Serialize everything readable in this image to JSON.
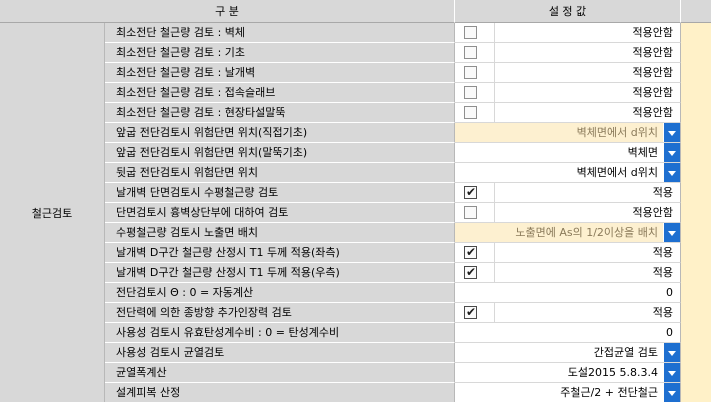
{
  "header": {
    "left": "구          분",
    "right": "설 정 값"
  },
  "category": "철근검토",
  "rows": [
    {
      "label": "최소전단 철근량 검토 : 벽체",
      "kind": "checkbox",
      "checked": false,
      "text": "적용안함"
    },
    {
      "label": "최소전단 철근량 검토 : 기초",
      "kind": "checkbox",
      "checked": false,
      "text": "적용안함"
    },
    {
      "label": "최소전단 철근량 검토 : 날개벽",
      "kind": "checkbox",
      "checked": false,
      "text": "적용안함"
    },
    {
      "label": "최소전단 철근량 검토 : 접속슬래브",
      "kind": "checkbox",
      "checked": false,
      "text": "적용안함"
    },
    {
      "label": "최소전단 철근량 검토 : 현장타설말뚝",
      "kind": "checkbox",
      "checked": false,
      "text": "적용안함"
    },
    {
      "label": "앞굽 전단검토시 위험단면 위치(직접기초)",
      "kind": "dropdown",
      "disabled": true,
      "text": "벽체면에서 d위치"
    },
    {
      "label": "앞굽 전단검토시 위험단면 위치(말뚝기초)",
      "kind": "dropdown",
      "disabled": false,
      "text": "벽체면"
    },
    {
      "label": "뒷굽 전단검토시 위험단면 위치",
      "kind": "dropdown",
      "disabled": false,
      "text": "벽체면에서 d위치"
    },
    {
      "label": "날개벽 단면검토시 수평철근량 검토",
      "kind": "checkbox",
      "checked": true,
      "text": "적용"
    },
    {
      "label": "단면검토시 흉벽상단부에 대하여 검토",
      "kind": "checkbox",
      "checked": false,
      "text": "적용안함"
    },
    {
      "label": "수평철근량 검토시 노출면 배치",
      "kind": "dropdown",
      "disabled": true,
      "text": "노출면에 As의 1/2이상을 배치"
    },
    {
      "label": "날개벽 D구간 철근량 산정시 T1 두께 적용(좌측)",
      "kind": "checkbox",
      "checked": true,
      "text": "적용"
    },
    {
      "label": "날개벽 D구간 철근량 산정시 T1 두께 적용(우측)",
      "kind": "checkbox",
      "checked": true,
      "text": "적용"
    },
    {
      "label": " 전단검토시 Θ : 0 = 자동계산",
      "kind": "number",
      "text": "0"
    },
    {
      "label": "전단력에 의한 종방향 추가인장력 검토",
      "kind": "checkbox",
      "checked": true,
      "text": "적용"
    },
    {
      "label": "사용성 검토시 유효탄성계수비 : 0 = 탄성계수비",
      "kind": "number",
      "text": "0"
    },
    {
      "label": "사용성 검토시 균열검토",
      "kind": "dropdown",
      "disabled": false,
      "text": "간접균열 검토"
    },
    {
      "label": "균열폭계산",
      "kind": "dropdown",
      "disabled": false,
      "text": "도설2015 5.8.3.4"
    },
    {
      "label": "설계피복 산정",
      "kind": "dropdown",
      "disabled": false,
      "text": "주철근/2 + 전단철근"
    }
  ]
}
